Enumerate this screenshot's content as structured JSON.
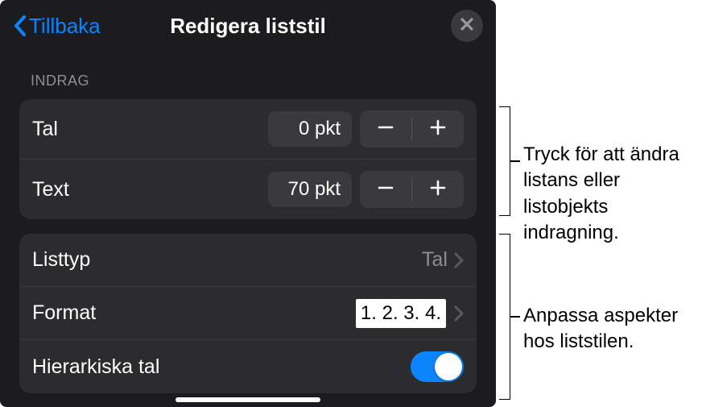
{
  "header": {
    "back_label": "Tillbaka",
    "title": "Redigera liststil"
  },
  "sections": {
    "indrag": {
      "header": "INDRAG",
      "tal": {
        "label": "Tal",
        "value": "0 pkt"
      },
      "text": {
        "label": "Text",
        "value": "70 pkt"
      }
    },
    "style": {
      "listtyp": {
        "label": "Listtyp",
        "value": "Tal"
      },
      "format": {
        "label": "Format",
        "value": "1. 2. 3. 4."
      },
      "hierarkiska": {
        "label": "Hierarkiska tal"
      }
    }
  },
  "callouts": {
    "top": "Tryck för att ändra listans eller listobjekts indragning.",
    "bottom": "Anpassa aspekter hos liststilen."
  }
}
